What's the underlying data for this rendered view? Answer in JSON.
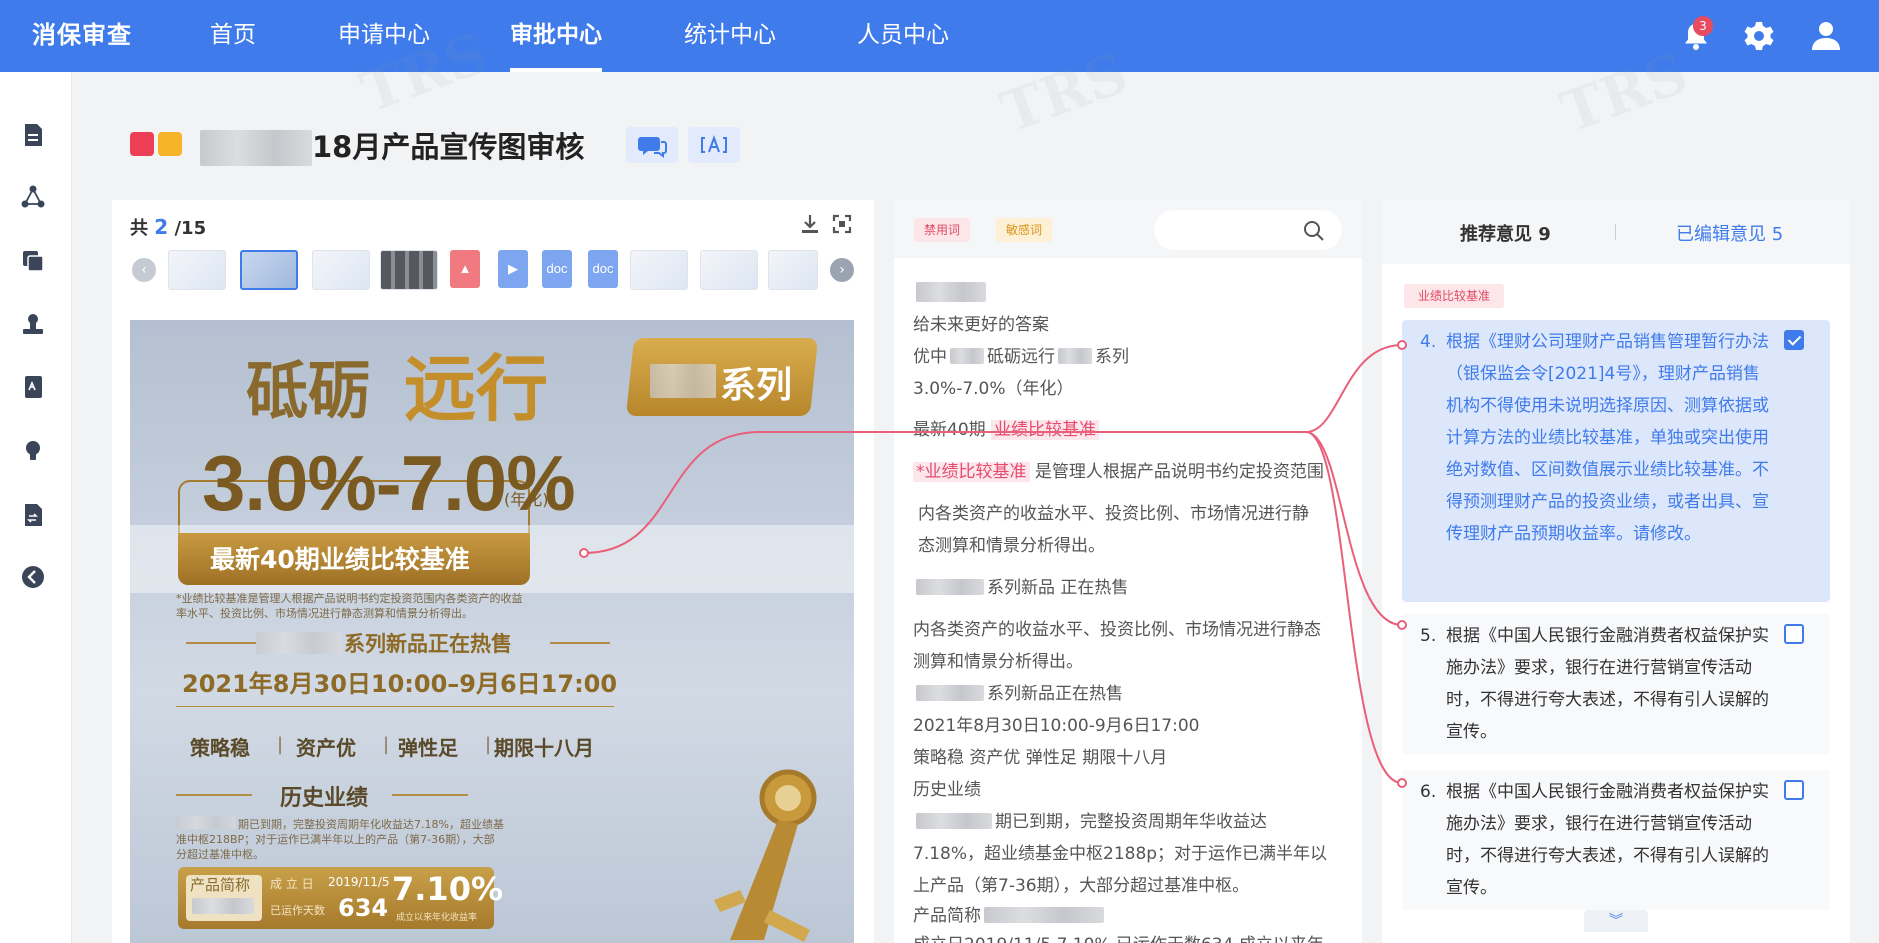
{
  "app": {
    "brand": "消保审查",
    "nav": [
      {
        "label": "首页",
        "active": false
      },
      {
        "label": "申请中心",
        "active": false
      },
      {
        "label": "审批中心",
        "active": true
      },
      {
        "label": "统计中心",
        "active": false
      },
      {
        "label": "人员中心",
        "active": false
      }
    ],
    "notification_count": "3",
    "icons": [
      "bell-icon",
      "gear-icon",
      "user-icon"
    ]
  },
  "sidebar": {
    "icons": [
      "document-icon",
      "share-icon",
      "copy-icon",
      "stamp-icon",
      "book-icon",
      "bulb-icon",
      "edit-document-icon",
      "back-arrow-icon"
    ]
  },
  "page": {
    "title": "18月产品宣传图审核"
  },
  "viewer": {
    "count_prefix": "共",
    "current": "2",
    "total": "/15",
    "file_labels": [
      "doc",
      "doc"
    ],
    "poster": {
      "title_a": "砥砺",
      "title_b": "远行",
      "series": "系列",
      "rate": "3.0%-7.0%",
      "rate_note": "(年化)",
      "band": "最新40期业绩比较基准",
      "footnote_1": "*业绩比较基准是管理人根据产品说明书约定投资范围内各类资产的收益",
      "footnote_2": "率水平、投资比例、市场情况进行静态测算和情景分析得出。",
      "new_product": "系列新品正在热售",
      "date_range": "2021年8月30日10:00–9月6日17:00",
      "features": [
        "策略稳",
        "资产优",
        "弹性足",
        "期限十八月"
      ],
      "history": "历史业绩",
      "history_1": "期已到期，完整投资周期年化收益达7.18%，超业绩基",
      "history_2": "准中枢218BP；对于运作已满半年以上的产品（第7-36期），大部",
      "history_3": "分超过基准中枢。",
      "card_label": "产品简称",
      "card_date_label": "成 立 日",
      "card_date": "2019/11/5",
      "card_days_label": "已运作天数",
      "card_days": "634",
      "card_rate": "7.10%",
      "card_rate_label": "成立以来年化收益率"
    }
  },
  "text_panel": {
    "tags": [
      "禁用词",
      "敏感词"
    ],
    "lines": {
      "l1": "给未来更好的答案",
      "l2a": "优中",
      "l2b": "砥砺远行",
      "l2c": "系列",
      "l3": "3.0%-7.0%（年化）",
      "l4a": "最新40期",
      "l4b": "业绩比较基准",
      "l5a": "*业绩比较基准",
      "l5b": "是管理人根据产品说明书约定投资范围",
      "l6": "内各类资产的收益水平、投资比例、市场情况进行静",
      "l7": "态测算和情景分析得出。",
      "l8": "系列新品  正在热售",
      "l9": "内各类资产的收益水平、投资比例、市场情况进行静态",
      "l10": "测算和情景分析得出。",
      "l11": "系列新品正在热售",
      "l12": "2021年8月30日10:00-9月6日17:00",
      "l13": "策略稳 资产优 弹性足 期限十八月",
      "l14": "历史业绩",
      "l15": "期已到期，完整投资周期年华收益达",
      "l16": "7.18%，超业绩基金中枢2188p；对于运作已满半年以",
      "l17": "上产品（第7-36期），大部分超过基准中枢。",
      "l18": "产品简称",
      "l19": "成立日2019/11/5 7.10% 已运作天数634 成立以来年"
    }
  },
  "opinions_panel": {
    "tab_recommended": "推荐意见 9",
    "tab_edited": "已编辑意见 5",
    "tag": "业绩比较基准",
    "items": [
      {
        "num": "4.",
        "text": "根据《理财公司理财产品销售管理暂行办法（银保监会令[2021]4号》，理财产品销售机构不得使用未说明选择原因、测算依据或计算方法的业绩比较基准，单独或突出使用绝对数值、区间数值展示业绩比较基准。不得预测理财产品的投资业绩，或者出具、宣传理财产品预期收益率。请修改。",
        "checked": true
      },
      {
        "num": "5.",
        "text": "根据《中国人民银行金融消费者权益保护实施办法》要求，银行在进行营销宣传活动时，不得进行夸大表述，不得有引人误解的宣传。",
        "checked": false
      },
      {
        "num": "6.",
        "text": "根据《中国人民银行金融消费者权益保护实施办法》要求，银行在进行营销宣传活动时，不得进行夸大表述，不得有引人误解的宣传。",
        "checked": false
      }
    ],
    "more": "︾"
  },
  "colors": {
    "primary": "#3f7bea",
    "highlight": "#e84a6d",
    "tag_ban": "#e04963",
    "tag_sensitive": "#d99515"
  }
}
